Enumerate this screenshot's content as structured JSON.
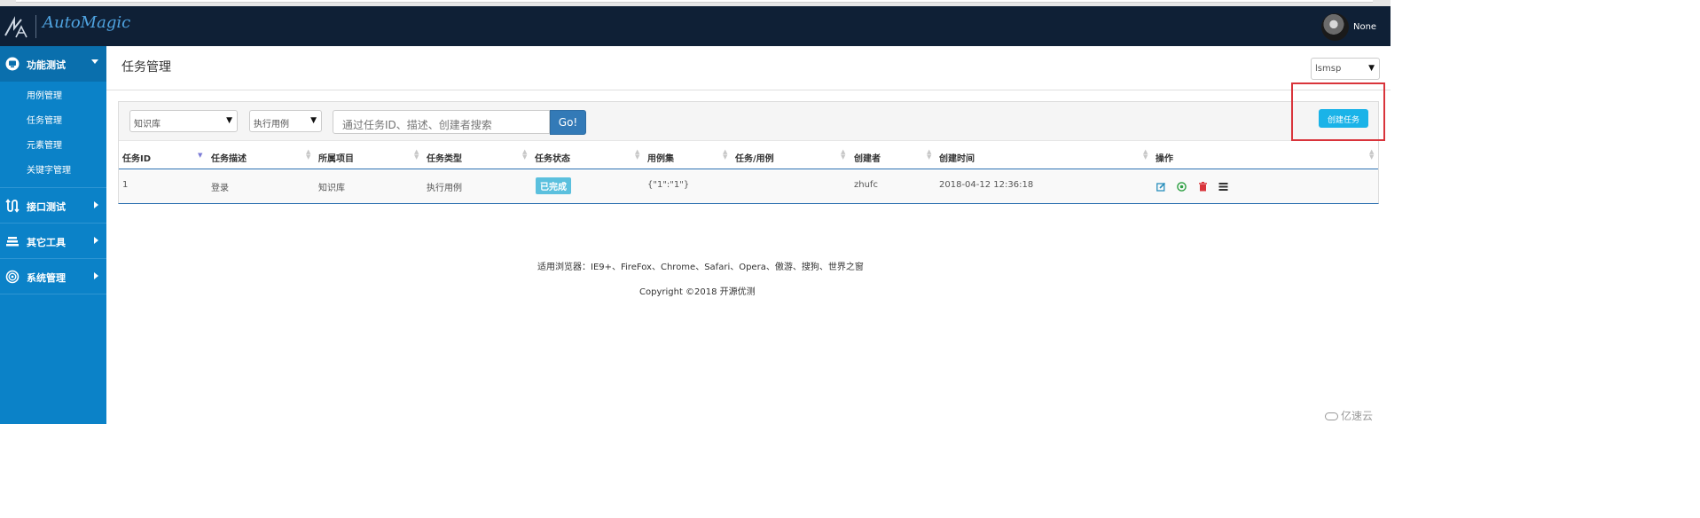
{
  "app": {
    "name": "AutoMagic",
    "user": "None"
  },
  "sidebar": {
    "sections": [
      {
        "label": "功能测试",
        "icon": "monitor-icon",
        "expanded": true,
        "items": [
          "用例管理",
          "任务管理",
          "元素管理",
          "关键字管理"
        ]
      },
      {
        "label": "接口测试",
        "icon": "api-icon",
        "expanded": false
      },
      {
        "label": "其它工具",
        "icon": "tools-icon",
        "expanded": false
      },
      {
        "label": "系统管理",
        "icon": "settings-icon",
        "expanded": false
      }
    ]
  },
  "header": {
    "title": "任务管理",
    "project_select": "lsmsp"
  },
  "toolbar": {
    "project_filter": "知识库",
    "type_filter": "执行用例",
    "search_placeholder": "通过任务ID、描述、创建者搜索",
    "go_label": "Go!",
    "create_label": "创建任务"
  },
  "table": {
    "columns": [
      "任务ID",
      "任务描述",
      "所属项目",
      "任务类型",
      "任务状态",
      "用例集",
      "任务/用例",
      "创建者",
      "创建时间",
      "操作"
    ],
    "rows": [
      {
        "id": "1",
        "desc": "登录",
        "project": "知识库",
        "type": "执行用例",
        "status": "已完成",
        "suite": "{\"1\":\"1\"}",
        "task_case": "",
        "creator": "zhufc",
        "created": "2018-04-12 12:36:18",
        "actions": [
          "edit-icon",
          "run-icon",
          "delete-icon",
          "list-icon"
        ]
      }
    ]
  },
  "footer": {
    "browsers": "适用浏览器：IE9+、FireFox、Chrome、Safari、Opera、傲游、搜狗、世界之窗",
    "copyright": "Copyright ©2018 开源优测"
  },
  "watermark": "亿速云",
  "colors": {
    "navbar": "#0f2036",
    "sidebar": "#0b82c8",
    "accent": "#1ab3e8",
    "go": "#337ab7",
    "badge": "#5bc0de",
    "highlight": "#d9343b"
  }
}
